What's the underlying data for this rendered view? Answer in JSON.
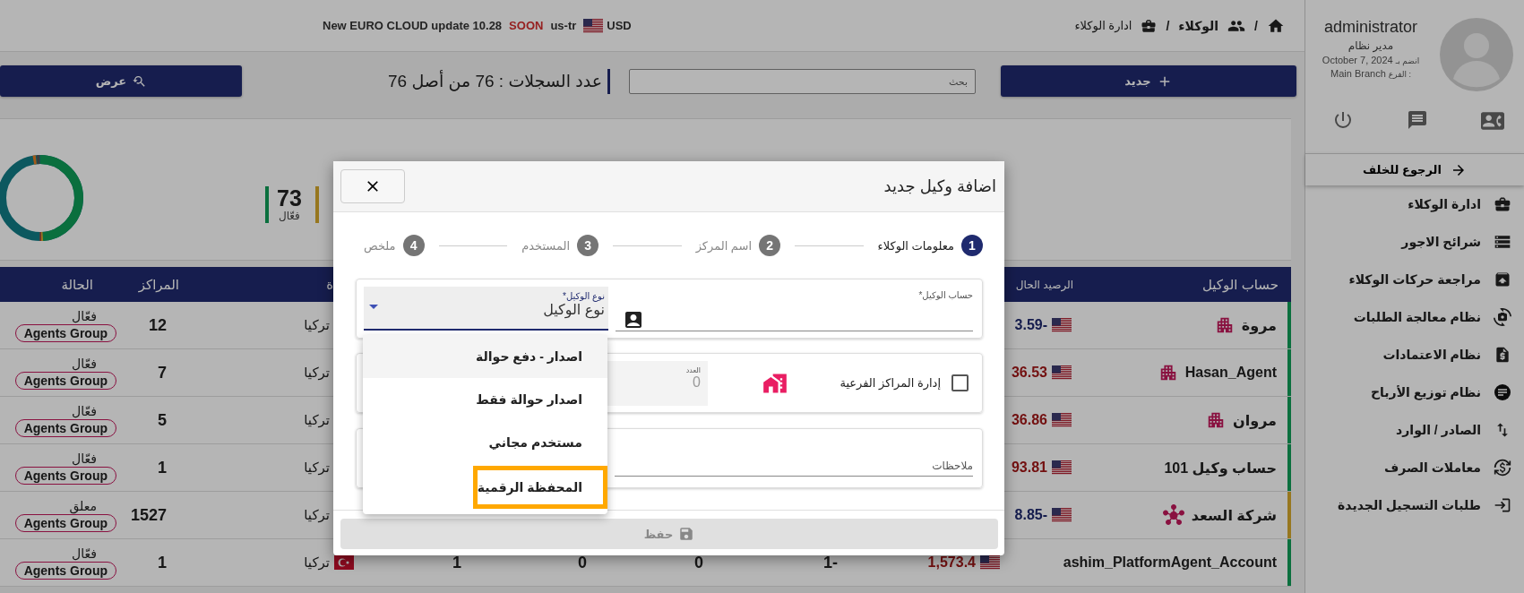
{
  "breadcrumb": [
    {
      "kind": "home"
    },
    {
      "kind": "separator",
      "text": "/"
    },
    {
      "kind": "agents",
      "text": "الوكلاء"
    },
    {
      "kind": "separator",
      "text": "/"
    },
    {
      "kind": "page",
      "text": "ادارة الوكلاء"
    }
  ],
  "announcement": {
    "text": "New EURO CLOUD update 10.28",
    "badge": "SOON",
    "locale": "us-tr",
    "currency": "USD"
  },
  "toolbar": {
    "new_button": "جديد",
    "search": {
      "placeholder": "بحث"
    },
    "record_count": "عدد السجلات : 76 من أصل 76",
    "view_button": "عرض"
  },
  "stats": [
    {
      "value": "73",
      "label": "فعّال",
      "color": "#0b6f3e"
    },
    {
      "color": "#97771f"
    }
  ],
  "table": {
    "columns": [
      "حساب الوكيل",
      "الرصيد الحال",
      "ة",
      "المراكز",
      "الحالة"
    ],
    "rows": [
      {
        "kind": "building",
        "status": "فعّال",
        "group": "Agents Group",
        "centers": "12",
        "country": "تركيا",
        "balance": "3.59-",
        "balance_negative": true,
        "account": "مروة",
        "color": "#0b6f3e"
      },
      {
        "kind": "building",
        "status": "فعّال",
        "group": "Agents Group",
        "centers": "7",
        "country": "تركيا",
        "balance": "36.53",
        "balance_negative": false,
        "account": "Hasan_Agent",
        "color": "#0b6f3e"
      },
      {
        "kind": "building",
        "status": "فعّال",
        "group": "Agents Group",
        "centers": "5",
        "country": "تركيا",
        "balance": "36.86",
        "balance_negative": false,
        "account": "مروان",
        "color": "#0b6f3e"
      },
      {
        "kind": "plain",
        "status": "فعّال",
        "group": "Agents Group",
        "centers": "1",
        "country": "تركيا",
        "balance": "93.81",
        "balance_negative": false,
        "account": "حساب وكيل 101",
        "color": "#0b6f3e"
      },
      {
        "kind": "network",
        "status": "معلق",
        "group": "Agents Group",
        "centers": "1527",
        "country": "تركيا",
        "balance": "8.85-",
        "balance_negative": true,
        "account": "شركة السعد",
        "color": "#97771f"
      },
      {
        "kind": "plain",
        "status": "فعّال",
        "group": "Agents Group",
        "centers": "1",
        "country": "تركيا",
        "cells": [
          "1-",
          "0",
          "0",
          "1"
        ],
        "balance": "1,573.4",
        "balance_negative": false,
        "account": "ashim_PlatformAgent_Account",
        "color": "#0b6f3e"
      }
    ]
  },
  "sidebar": {
    "user": {
      "name": "administrator",
      "role": "مدير نظام",
      "joined_label": "انضم بـ",
      "joined_date": "October 7, 2024",
      "branch_label": "الفرع :",
      "branch": "Main Branch"
    },
    "back": "الرجوع للخلف",
    "menu": [
      {
        "kind": "bag",
        "label": "ادارة الوكلاء"
      },
      {
        "kind": "list",
        "label": "شرائح الاجور"
      },
      {
        "kind": "archive",
        "label": "مراجعة حركات الوكلاء"
      },
      {
        "kind": "camera",
        "label": "نظام معالجة الطلبات"
      },
      {
        "kind": "invoice",
        "label": "نظام الاعتمادات"
      },
      {
        "kind": "notes",
        "label": "نظام توزيع الأرباح"
      },
      {
        "kind": "swap",
        "label": "الصادر / الوارد"
      },
      {
        "kind": "exchange",
        "label": "معاملات الصرف"
      },
      {
        "kind": "login",
        "label": "طلبات التسجيل الجديدة"
      }
    ]
  },
  "modal": {
    "title": "اضافة وكيل جديد",
    "steps": [
      {
        "number": "1",
        "label": "معلومات الوكلاء",
        "selected": true
      },
      {
        "number": "2",
        "label": "اسم المركز",
        "selected": false
      },
      {
        "number": "3",
        "label": "المستخدم",
        "selected": false
      },
      {
        "number": "4",
        "label": "ملخص",
        "selected": false
      }
    ],
    "account_field": {
      "label": "حساب الوكيل*"
    },
    "type_select": {
      "label": "نوع الوكيل*",
      "value": "نوع الوكيل",
      "expanded": true
    },
    "options": [
      {
        "label": "اصدار - دفع حوالة",
        "highlighted": true,
        "annotated": false
      },
      {
        "label": "اصدار حوالة فقط",
        "highlighted": false,
        "annotated": false
      },
      {
        "label": "مستخدم مجاني",
        "highlighted": false,
        "annotated": false
      },
      {
        "label": "المحفظة الرقمية",
        "highlighted": false,
        "annotated": true
      }
    ],
    "sub_centers": {
      "label": "إدارة المراكز الفرعية",
      "checked": false
    },
    "count_field": {
      "label": "العدد",
      "value": "0",
      "disabled": true
    },
    "notes_field": {
      "label": "ملاحظات"
    },
    "save_button": {
      "label": "حفظ",
      "disabled": true
    }
  }
}
